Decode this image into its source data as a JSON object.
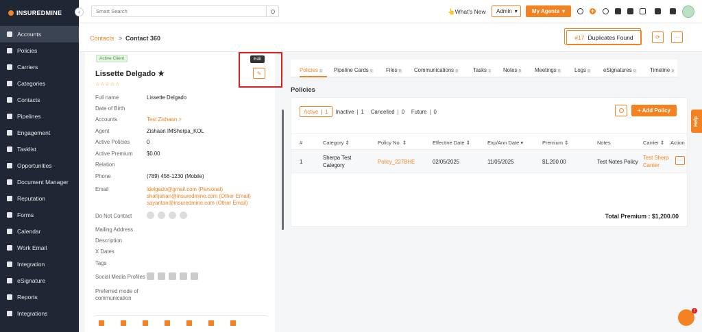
{
  "brand": {
    "logo_text": "INSUREDMINE"
  },
  "sidebar": {
    "items": [
      {
        "label": "Accounts",
        "active": true
      },
      {
        "label": "Policies"
      },
      {
        "label": "Carriers"
      },
      {
        "label": "Categories"
      },
      {
        "label": "Contacts"
      },
      {
        "label": "Pipelines"
      },
      {
        "label": "Engagement"
      },
      {
        "label": "Tasklist"
      },
      {
        "label": "Opportunities"
      },
      {
        "label": "Document Manager"
      },
      {
        "label": "Reputation"
      },
      {
        "label": "Forms"
      },
      {
        "label": "Calendar"
      },
      {
        "label": "Work Email"
      },
      {
        "label": "Integration"
      },
      {
        "label": "eSignature"
      },
      {
        "label": "Reports"
      },
      {
        "label": "Integrations"
      }
    ]
  },
  "header": {
    "search_placeholder": "Smart Search",
    "whats_new": "What's New",
    "role": "Admin",
    "my_agents": "My Agents"
  },
  "breadcrumb": {
    "parent": "Contacts",
    "separator": ">",
    "current": "Contact 360"
  },
  "duplicates": {
    "count": "#17",
    "label": "Duplicates Found"
  },
  "profile": {
    "status_badge": "Active Client",
    "name": "Lissette Delgado",
    "star": "★",
    "rating_stars": "☆☆☆☆☆",
    "edit_tooltip": "Edit",
    "fields": [
      {
        "label": "Full name",
        "value": "Lissette Delgado"
      },
      {
        "label": "Date of Birth",
        "value": ""
      },
      {
        "label": "Accounts",
        "value": "Test Zishaan >"
      },
      {
        "label": "Agent",
        "value": "Zishaan IMSherpa_KOL"
      },
      {
        "label": "Active Policies",
        "value": "0"
      },
      {
        "label": "Active Premium",
        "value": "$0.00"
      },
      {
        "label": "Relation",
        "value": ""
      },
      {
        "label": "Phone",
        "value": "(789) 456-1230 (Mobile)"
      }
    ],
    "email_label": "Email",
    "emails": [
      "ldelgado@gmail.com  (Personal)",
      "shahjahan@insuredmine.com  (Other Email)",
      "sayantan@insuredmine.com  (Other Email)"
    ],
    "more_fields": [
      {
        "label": "Do Not Contact"
      },
      {
        "label": "Mailing Address"
      },
      {
        "label": "Description"
      },
      {
        "label": "X Dates"
      },
      {
        "label": "Tags"
      },
      {
        "label": "Social Media Profiles"
      },
      {
        "label": "Preferred mode of"
      },
      {
        "label": "communication"
      }
    ]
  },
  "tabs": [
    {
      "label": "Policies",
      "count": "1"
    },
    {
      "label": "Pipeline Cards",
      "count": "0"
    },
    {
      "label": "Files",
      "count": "0"
    },
    {
      "label": "Communications",
      "count": "0"
    },
    {
      "label": "Tasks",
      "count": "1"
    },
    {
      "label": "Notes",
      "count": "0"
    },
    {
      "label": "Meetings",
      "count": "0"
    },
    {
      "label": "Logs",
      "count": "0"
    },
    {
      "label": "eSignatures",
      "count": "0"
    },
    {
      "label": "Timeline",
      "count": "0"
    }
  ],
  "policies": {
    "title": "Policies",
    "filters": [
      {
        "label": "Active",
        "count": "1"
      },
      {
        "label": "Inactive",
        "count": "1"
      },
      {
        "label": "Cancelled",
        "count": "0"
      },
      {
        "label": "Future",
        "count": "0"
      }
    ],
    "add_label": "+ Add Policy",
    "columns": [
      "#",
      "Category ⇕",
      "Policy No. ⇕",
      "Effective Date ⇕",
      "Exp/Ann Date ▾",
      "Premium ⇕",
      "Notes",
      "Carrier ⇕",
      "Action"
    ],
    "row": {
      "num": "1",
      "category_1": "Sherpa Test",
      "category_2": "Category",
      "policy_no": "Policy_227BHE",
      "effective": "02/05/2025",
      "exp": "11/05/2025",
      "premium": "$1,200.00",
      "notes": "Test Notes Policy",
      "carrier_1": "Test Sherpa",
      "carrier_2": "Carrier",
      "action": "···"
    },
    "total": "Total Premium : $1,200.00"
  },
  "help_label": "Help",
  "chat_badge": "1",
  "colors": {
    "accent": "#f58220",
    "sidebar": "#1e2733",
    "highlight": "#d91f1f"
  }
}
